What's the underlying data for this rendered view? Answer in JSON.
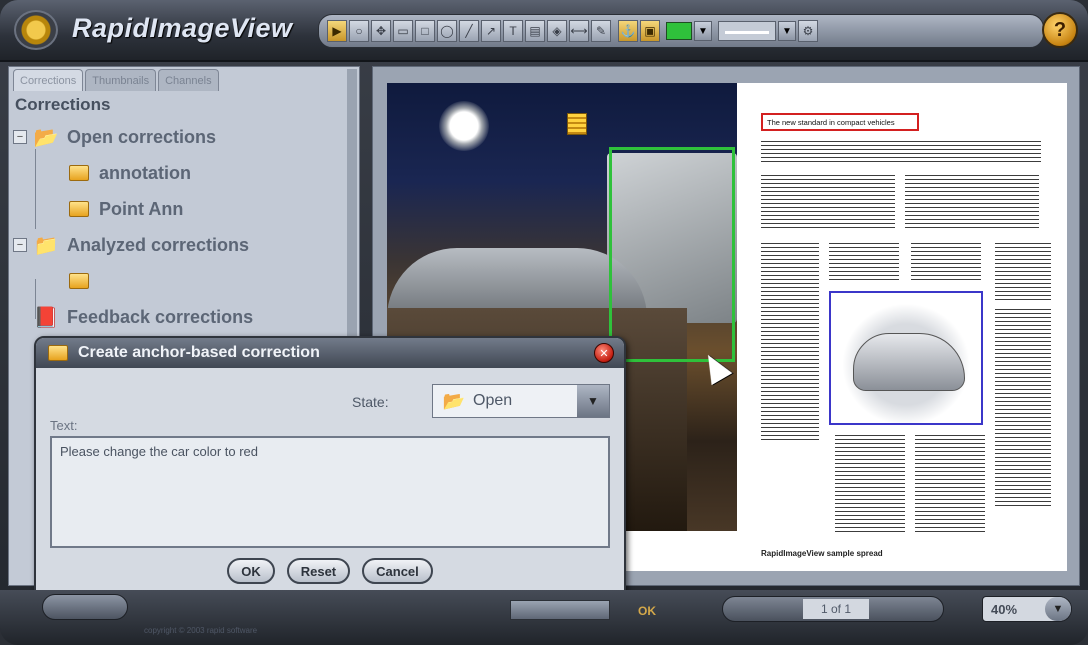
{
  "app": {
    "title": "RapidImageView",
    "help_glyph": "?"
  },
  "toolbar": {
    "tools": [
      "pointer-icon",
      "zoom-icon",
      "pan-icon",
      "note-icon",
      "rect-icon",
      "ellipse-icon",
      "line-icon",
      "arrow-icon",
      "text-icon",
      "highlight-icon",
      "stamp-icon",
      "measure-icon",
      "pen-icon",
      "anchor-icon",
      "comment-icon"
    ],
    "active_color": "#2fc13b"
  },
  "sidebar": {
    "tabs": [
      "Corrections",
      "Thumbnails",
      "Channels"
    ],
    "heading": "Corrections",
    "groups": [
      {
        "label": "Open corrections",
        "children": [
          "annotation",
          "Point Ann"
        ]
      },
      {
        "label": "Analyzed corrections",
        "children": [
          ""
        ]
      },
      {
        "label": "Feedback corrections",
        "children": []
      }
    ]
  },
  "document": {
    "headline": "The new standard in compact vehicles",
    "footer_text": "RapidImageView sample spread"
  },
  "dialog": {
    "title": "Create anchor-based correction",
    "state_label": "State:",
    "state_value": "Open",
    "text_label": "Text:",
    "text_value": "Please change the car color to red",
    "buttons": [
      "OK",
      "Reset",
      "Cancel"
    ]
  },
  "status": {
    "copyright": "copyright © 2003 rapid software",
    "ok": "OK",
    "page": "1 of 1",
    "zoom": "40%"
  }
}
